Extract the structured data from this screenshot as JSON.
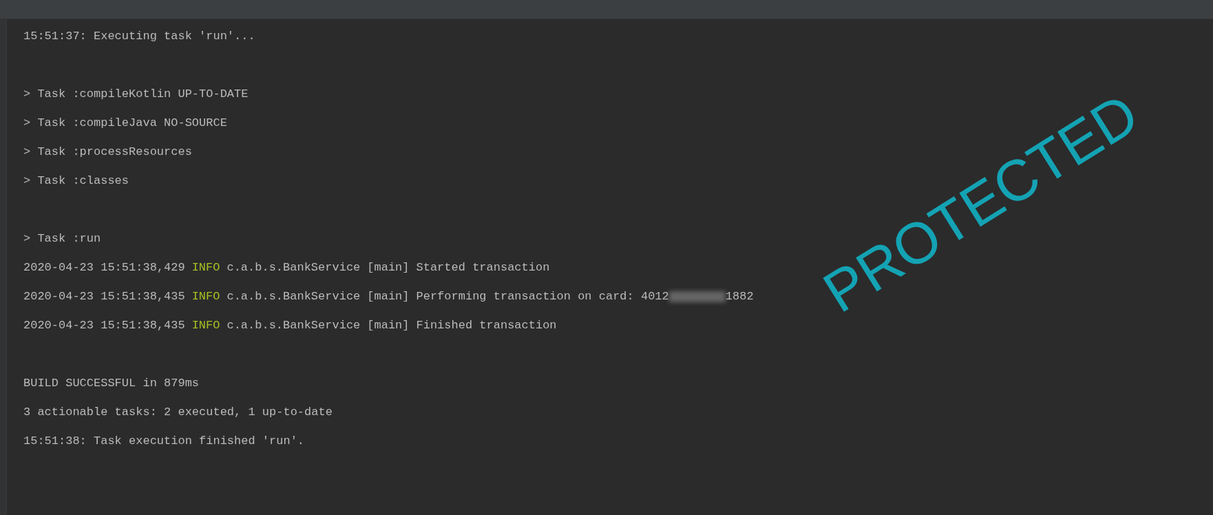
{
  "console": {
    "lines": [
      {
        "kind": "plain",
        "text": "15:51:37: Executing task 'run'..."
      },
      {
        "kind": "blank"
      },
      {
        "kind": "plain",
        "text": "> Task :compileKotlin UP-TO-DATE"
      },
      {
        "kind": "plain",
        "text": "> Task :compileJava NO-SOURCE"
      },
      {
        "kind": "plain",
        "text": "> Task :processResources"
      },
      {
        "kind": "plain",
        "text": "> Task :classes"
      },
      {
        "kind": "blank"
      },
      {
        "kind": "plain",
        "text": "> Task :run"
      },
      {
        "kind": "log",
        "timestamp": "2020-04-23 15:51:38,429",
        "severity": "INFO",
        "logger": "c.a.b.s.BankService",
        "thread": "[main]",
        "message": "Started transaction"
      },
      {
        "kind": "log",
        "timestamp": "2020-04-23 15:51:38,435",
        "severity": "INFO",
        "logger": "c.a.b.s.BankService",
        "thread": "[main]",
        "message": "Performing transaction on card: 4012",
        "masked": true,
        "message_tail": "1882"
      },
      {
        "kind": "log",
        "timestamp": "2020-04-23 15:51:38,435",
        "severity": "INFO",
        "logger": "c.a.b.s.BankService",
        "thread": "[main]",
        "message": "Finished transaction"
      },
      {
        "kind": "blank"
      },
      {
        "kind": "plain",
        "text": "BUILD SUCCESSFUL in 879ms"
      },
      {
        "kind": "plain",
        "text": "3 actionable tasks: 2 executed, 1 up-to-date"
      },
      {
        "kind": "plain",
        "text": "15:51:38: Task execution finished 'run'."
      }
    ]
  },
  "stamp": {
    "text": "PROTECTED"
  }
}
